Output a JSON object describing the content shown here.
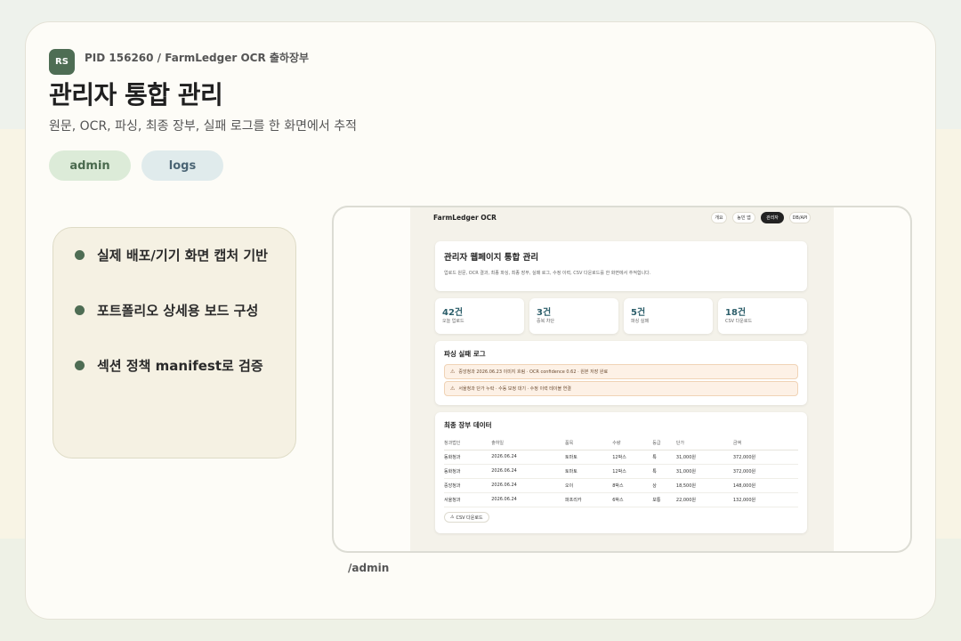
{
  "header": {
    "avatar": "RS",
    "pid": "PID 156260 / FarmLedger OCR 출하장부",
    "title": "관리자 통합 관리",
    "subtitle": "원문, OCR, 파싱, 최종 장부, 실패 로그를 한 화면에서 추적"
  },
  "chips": [
    "admin",
    "logs"
  ],
  "features": [
    "실제 배포/기기 화면 캡처 기반",
    "포트폴리오 상세용 보드 구성",
    "섹션 정책 manifest로 검증"
  ],
  "screenshot": {
    "brand": "FarmLedger OCR",
    "nav": [
      "개요",
      "농민 앱",
      "관리자",
      "DB/API"
    ],
    "nav_active": "관리자",
    "page_title": "관리자 웹페이지 통합 관리",
    "page_sub": "업로드 원문, OCR 결과, 최종 파싱, 최종 장부, 실패 로그, 수정 이력, CSV 다운로드를 한 화면에서 추적합니다.",
    "stats": [
      {
        "value": "42건",
        "label": "오늘 업로드"
      },
      {
        "value": "3건",
        "label": "중복 차단"
      },
      {
        "value": "5건",
        "label": "파싱 실패"
      },
      {
        "value": "18건",
        "label": "CSV 다운로드"
      }
    ],
    "log_title": "파싱 실패 로그",
    "logs": [
      "중앙청과 2026.06.23 이미지 흐림 · OCR confidence 0.62 · 원본 저장 완료",
      "서울청과 단가 누락 · 수동 보정 대기 · 수정 이력 테이블 연결"
    ],
    "ledger_title": "최종 장부 데이터",
    "columns": [
      "청과법인",
      "출하일",
      "품목",
      "수량",
      "등급",
      "단가",
      "금액"
    ],
    "rows": [
      [
        "동화청과",
        "2026.06.24",
        "토마토",
        "12박스",
        "특",
        "31,000원",
        "372,000원"
      ],
      [
        "동화청과",
        "2026.06.24",
        "토마토",
        "12박스",
        "특",
        "31,000원",
        "372,000원"
      ],
      [
        "중앙청과",
        "2026.06.24",
        "오이",
        "8박스",
        "상",
        "18,500원",
        "148,000원"
      ],
      [
        "서울청과",
        "2026.06.24",
        "파프리카",
        "6박스",
        "보통",
        "22,000원",
        "132,000원"
      ]
    ],
    "csv_button": "CSV 다운로드"
  },
  "route": "/admin",
  "colors": {
    "accent": "#4e6d54",
    "stat": "#2c5e6a",
    "alert_bg": "#fdf1e6"
  }
}
